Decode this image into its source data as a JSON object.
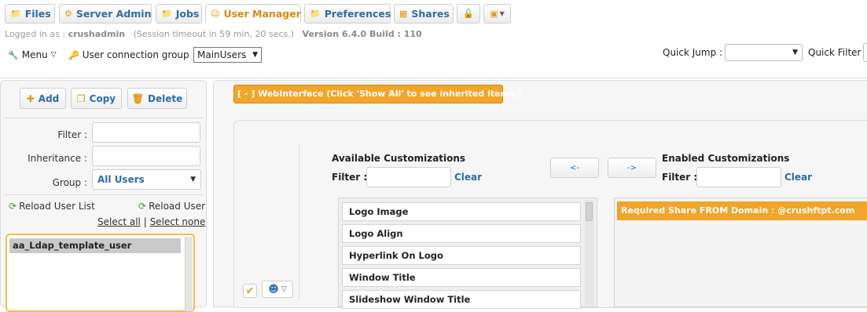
{
  "nav": {
    "tabs": [
      {
        "label": "Files",
        "icon": "folder-icon"
      },
      {
        "label": "Server Admin",
        "icon": "gear-icon"
      },
      {
        "label": "Jobs",
        "icon": "folder-icon"
      },
      {
        "label": "User Manager",
        "icon": "user-icon"
      },
      {
        "label": "Preferences",
        "icon": "folder-icon"
      },
      {
        "label": "Shares",
        "icon": "bars-icon"
      }
    ],
    "active_tab": "User Manager"
  },
  "session": {
    "logged_in_prefix": "Logged in as :",
    "user": "crushadmin",
    "timeout": "(Session timeout in 59 min, 20 secs.)",
    "version": "Version 6.4.0 Build : 110"
  },
  "toolbar": {
    "menu_label": "Menu",
    "connection_group_label": "User connection group :",
    "connection_group_value": "MainUsers",
    "quick_jump_label": "Quick Jump :",
    "quick_jump_value": "",
    "quick_filter_label": "Quick Filter"
  },
  "left": {
    "add_label": "Add",
    "copy_label": "Copy",
    "delete_label": "Delete",
    "filter_label": "Filter :",
    "inheritance_label": "Inheritance :",
    "group_label": "Group :",
    "group_value": "All Users",
    "reload_list_label": "Reload User List",
    "reload_user_label": "Reload User",
    "select_all_label": "Select all",
    "separator": "|",
    "select_none_label": "Select none",
    "users": [
      "aa_Ldap_template_user"
    ]
  },
  "right": {
    "section_header": "[ - ] WebInterface (Click 'Show All' to see inherited items.)",
    "available_title": "Available Customizations",
    "enabled_title": "Enabled Customizations",
    "filter_label": "Filter :",
    "clear_label": "Clear",
    "move_left_label": "<-",
    "move_right_label": "->",
    "available_items": [
      "Logo Image",
      "Logo Align",
      "Hyperlink On Logo",
      "Window Title",
      "Slideshow Window Title"
    ],
    "enabled_items": [
      "Required Share FROM Domain : @crushftpt.com"
    ]
  },
  "colors": {
    "accent_orange": "#f1a52b",
    "link_blue": "#2d6ea6",
    "selection_border": "#f0c04a"
  }
}
